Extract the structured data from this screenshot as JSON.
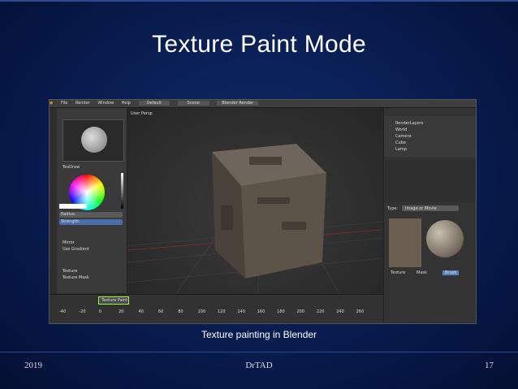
{
  "slide": {
    "title": "Texture Paint Mode",
    "caption": "Texture painting in Blender",
    "footer_left": "2019",
    "footer_center": "DrTAD",
    "footer_right": "17"
  },
  "blender": {
    "menu": [
      "File",
      "Render",
      "Window",
      "Help"
    ],
    "layout": "Default",
    "scene": "Scene",
    "engine": "Blender Render",
    "viewport_label": "User Persp",
    "active_tool_label": "Texture Paint",
    "toolshelf": {
      "brush_name": "TexDraw",
      "radius_label": "Radius:",
      "strength_label": "Strength:",
      "options": [
        "Mirror",
        "Use Gradient"
      ],
      "sections": [
        "Texture",
        "Texture Mask"
      ]
    },
    "outliner": [
      "RenderLayers",
      "World",
      "Camera",
      "Cube",
      "Lamp"
    ],
    "texture_panel": {
      "type_label": "Type:",
      "type_value": "Image or Movie",
      "tabs": [
        "Texture",
        "Mask",
        "Brush"
      ]
    },
    "timeline_ticks": [
      "-40",
      "-20",
      "0",
      "20",
      "40",
      "60",
      "80",
      "100",
      "120",
      "140",
      "160",
      "180",
      "200",
      "220",
      "240",
      "260"
    ],
    "colors": {
      "accent": "#5680c2",
      "selected": "#f0a020"
    }
  }
}
